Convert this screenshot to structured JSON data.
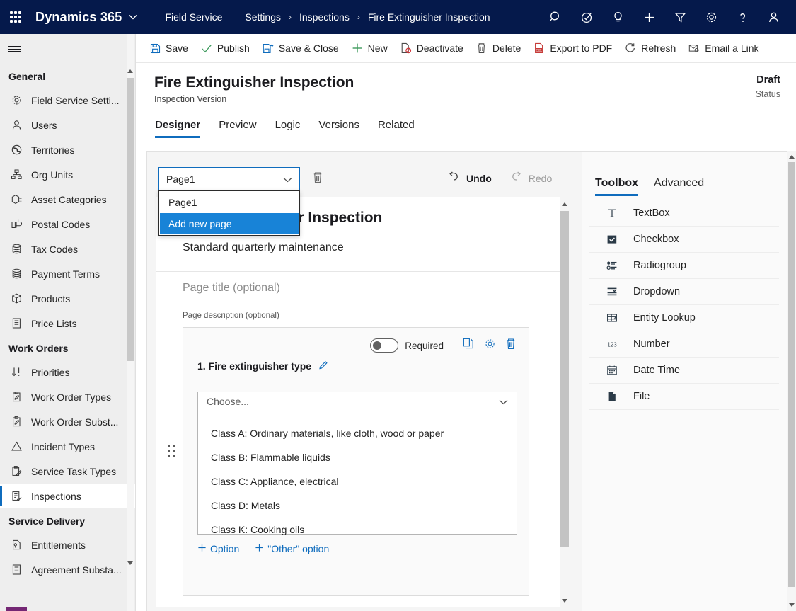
{
  "topbar": {
    "waffle_label": "app-launcher",
    "brand": "Dynamics 365",
    "app_name": "Field Service",
    "breadcrumbs": [
      "Settings",
      "Inspections",
      "Fire Extinguisher Inspection"
    ],
    "separator": "›",
    "icons": [
      "search-icon",
      "target-icon",
      "lightbulb-icon",
      "plus-icon",
      "filter-icon",
      "gear-icon",
      "help-icon",
      "user-icon"
    ]
  },
  "sidebar": {
    "groups": [
      {
        "label": "General",
        "items": [
          {
            "label": "Field Service Setti...",
            "icon": "gear-icon"
          },
          {
            "label": "Users",
            "icon": "user-icon"
          },
          {
            "label": "Territories",
            "icon": "globe-icon"
          },
          {
            "label": "Org Units",
            "icon": "org-chart-icon"
          },
          {
            "label": "Asset Categories",
            "icon": "asset-icon"
          },
          {
            "label": "Postal Codes",
            "icon": "mailbox-icon"
          },
          {
            "label": "Tax Codes",
            "icon": "database-icon"
          },
          {
            "label": "Payment Terms",
            "icon": "database-icon"
          },
          {
            "label": "Products",
            "icon": "box-icon"
          },
          {
            "label": "Price Lists",
            "icon": "document-icon"
          }
        ]
      },
      {
        "label": "Work Orders",
        "items": [
          {
            "label": "Priorities",
            "icon": "sort-icon"
          },
          {
            "label": "Work Order Types",
            "icon": "clipboard-icon"
          },
          {
            "label": "Work Order Subst...",
            "icon": "clipboard-icon"
          },
          {
            "label": "Incident Types",
            "icon": "warning-icon"
          },
          {
            "label": "Service Task Types",
            "icon": "clipboard-pen-icon"
          },
          {
            "label": "Inspections",
            "icon": "clipboard-check-icon",
            "selected": true
          }
        ]
      },
      {
        "label": "Service Delivery",
        "items": [
          {
            "label": "Entitlements",
            "icon": "entitlement-icon"
          },
          {
            "label": "Agreement Substa...",
            "icon": "document-icon"
          }
        ]
      }
    ]
  },
  "command_bar": {
    "commands": [
      {
        "label": "Save",
        "icon": "save-icon"
      },
      {
        "label": "Publish",
        "icon": "check-icon"
      },
      {
        "label": "Save & Close",
        "icon": "save-close-icon"
      },
      {
        "label": "New",
        "icon": "plus-icon"
      },
      {
        "label": "Deactivate",
        "icon": "deactivate-icon"
      },
      {
        "label": "Delete",
        "icon": "trash-icon"
      },
      {
        "label": "Export to PDF",
        "icon": "pdf-icon"
      },
      {
        "label": "Refresh",
        "icon": "refresh-icon"
      },
      {
        "label": "Email a Link",
        "icon": "email-link-icon"
      }
    ]
  },
  "record": {
    "title": "Fire Extinguisher Inspection",
    "subtitle": "Inspection Version",
    "status_value": "Draft",
    "status_label": "Status",
    "tabs": [
      {
        "label": "Designer",
        "active": true
      },
      {
        "label": "Preview"
      },
      {
        "label": "Logic"
      },
      {
        "label": "Versions"
      },
      {
        "label": "Related"
      }
    ]
  },
  "designer": {
    "page_select": {
      "value": "Page1",
      "open": true,
      "options": [
        {
          "label": "Page1"
        },
        {
          "label": "Add new page",
          "highlighted": true
        }
      ]
    },
    "delete_page_icon": "trash-icon",
    "undo_label": "Undo",
    "redo_label": "Redo",
    "form": {
      "title": "Fire Extinguisher Inspection",
      "description": "Standard quarterly maintenance",
      "page_title_placeholder": "Page title (optional)",
      "page_description_placeholder": "Page description (optional)"
    },
    "question": {
      "required_label": "Required",
      "required_on": false,
      "number_and_label": "1. Fire extinguisher type",
      "edit_icon": "pencil-icon",
      "copy_icon": "copy-icon",
      "settings_icon": "gear-icon",
      "delete_icon": "trash-icon",
      "choose_placeholder": "Choose...",
      "options": [
        "Class A: Ordinary materials, like cloth, wood or paper",
        "Class B: Flammable liquids",
        "Class C: Appliance, electrical",
        "Class D: Metals",
        "Class K: Cooking oils"
      ],
      "add_option_label": "Option",
      "add_other_option_label": "\"Other\" option"
    }
  },
  "toolbox": {
    "tabs": [
      {
        "label": "Toolbox",
        "active": true
      },
      {
        "label": "Advanced"
      }
    ],
    "items": [
      {
        "label": "TextBox",
        "icon": "text-icon"
      },
      {
        "label": "Checkbox",
        "icon": "checkbox-icon"
      },
      {
        "label": "Radiogroup",
        "icon": "radiogroup-icon"
      },
      {
        "label": "Dropdown",
        "icon": "dropdown-icon"
      },
      {
        "label": "Entity Lookup",
        "icon": "entity-lookup-icon"
      },
      {
        "label": "Number",
        "icon": "number-icon"
      },
      {
        "label": "Date Time",
        "icon": "calendar-icon"
      },
      {
        "label": "File",
        "icon": "file-icon"
      }
    ]
  },
  "colors": {
    "topbar_bg": "#05194b",
    "accent": "#0f6cbd",
    "menu_highlight": "#1883d7",
    "sidebar_bg": "#eeeeee"
  }
}
